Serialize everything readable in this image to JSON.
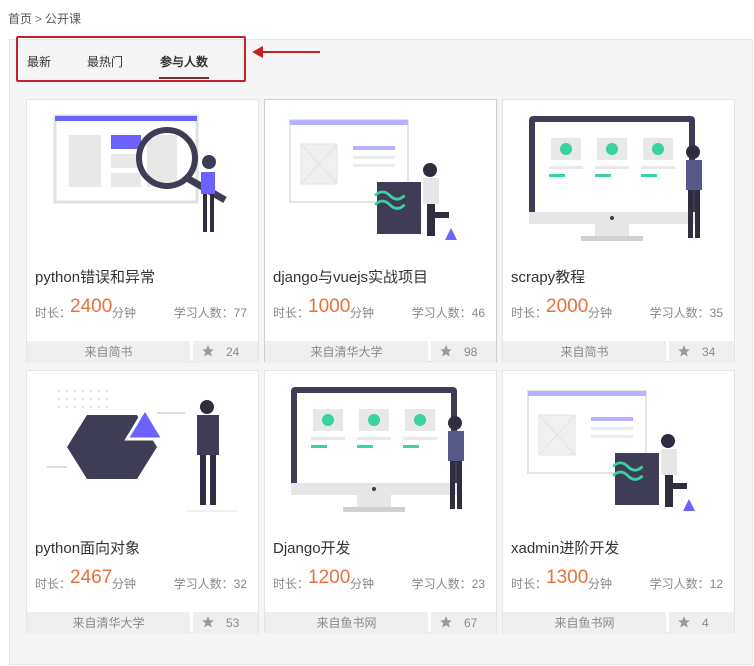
{
  "breadcrumb": {
    "home": "首页",
    "separator": ">",
    "current": "公开课"
  },
  "tabs": [
    {
      "label": "最新",
      "active": false
    },
    {
      "label": "最热门",
      "active": false
    },
    {
      "label": "参与人数",
      "active": true
    }
  ],
  "labels": {
    "duration": "时长：",
    "unit": "分钟",
    "learners": "学习人数："
  },
  "colors": {
    "accent": "#e6713a",
    "highlight": "#c8202a",
    "purple": "#6c63ff",
    "teal": "#3ad29f"
  },
  "courses": [
    {
      "title": "python错误和异常",
      "duration": "2400",
      "learners": "77",
      "source": "来自简书",
      "favorites": "24",
      "illustration": "search-magnifier-woman"
    },
    {
      "title": "django与vuejs实战项目",
      "duration": "1000",
      "learners": "46",
      "source": "来自清华大学",
      "favorites": "98",
      "illustration": "tailwind-man"
    },
    {
      "title": "scrapy教程",
      "duration": "2000",
      "learners": "35",
      "source": "来自简书",
      "favorites": "34",
      "illustration": "monitor-man"
    },
    {
      "title": "python面向对象",
      "duration": "2467",
      "learners": "32",
      "source": "来自清华大学",
      "favorites": "53",
      "illustration": "hexagon-man"
    },
    {
      "title": "Django开发",
      "duration": "1200",
      "learners": "23",
      "source": "来自鱼书网",
      "favorites": "67",
      "illustration": "monitor-man"
    },
    {
      "title": "xadmin进阶开发",
      "duration": "1300",
      "learners": "12",
      "source": "来自鱼书网",
      "favorites": "4",
      "illustration": "tailwind-man"
    }
  ]
}
